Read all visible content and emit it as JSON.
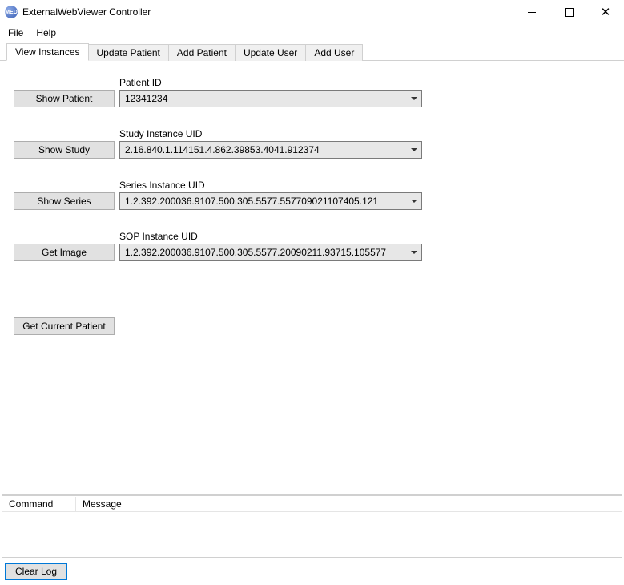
{
  "window": {
    "title": "ExternalWebViewer Controller",
    "icon_text": "MED"
  },
  "menubar": {
    "file": "File",
    "help": "Help"
  },
  "tabs": [
    {
      "label": "View Instances",
      "active": true
    },
    {
      "label": "Update Patient",
      "active": false
    },
    {
      "label": "Add Patient",
      "active": false
    },
    {
      "label": "Update User",
      "active": false
    },
    {
      "label": "Add User",
      "active": false
    }
  ],
  "form": {
    "patient": {
      "button": "Show Patient",
      "label": "Patient ID",
      "value": "12341234"
    },
    "study": {
      "button": "Show Study",
      "label": "Study Instance UID",
      "value": "2.16.840.1.114151.4.862.39853.4041.912374"
    },
    "series": {
      "button": "Show Series",
      "label": "Series Instance UID",
      "value": "1.2.392.200036.9107.500.305.5577.557709021107405.121"
    },
    "sop": {
      "button": "Get Image",
      "label": "SOP Instance UID",
      "value": "1.2.392.200036.9107.500.305.5577.20090211.93715.105577"
    },
    "get_current": "Get Current Patient"
  },
  "log": {
    "col_command": "Command",
    "col_message": "Message"
  },
  "footer": {
    "clear": "Clear Log"
  }
}
